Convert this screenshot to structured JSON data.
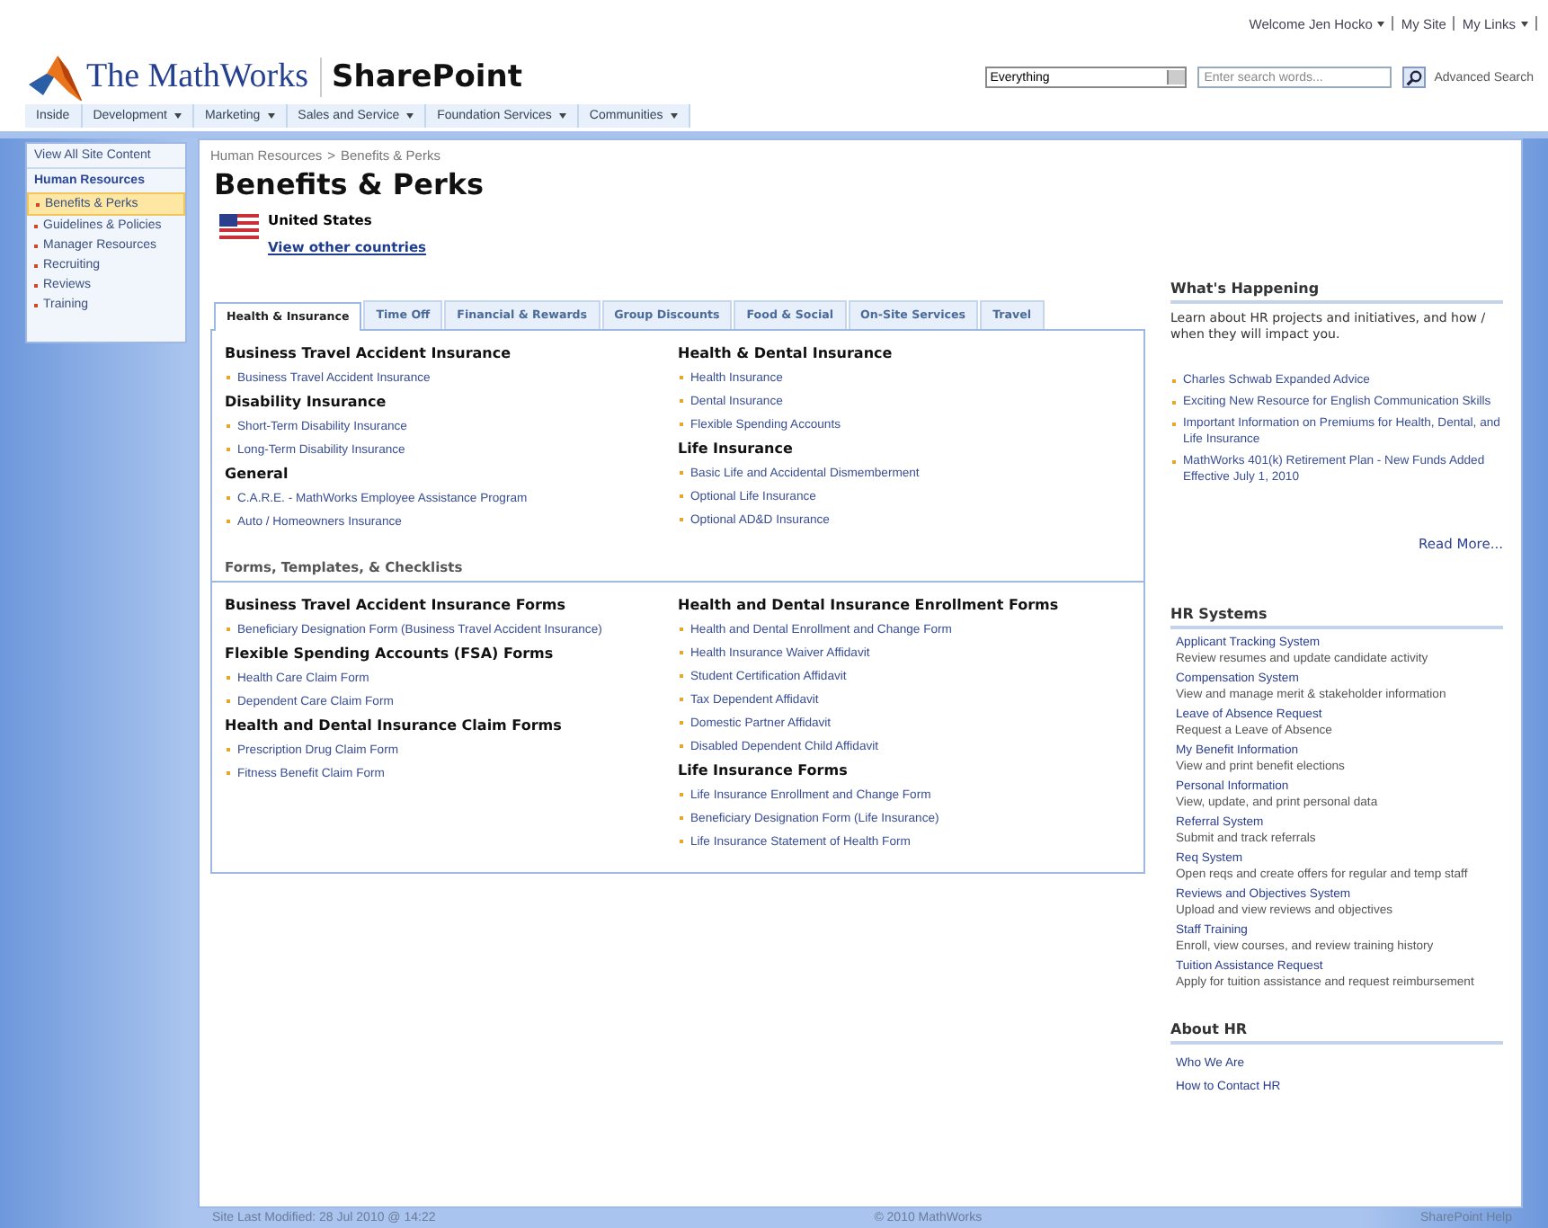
{
  "top_links": {
    "welcome": "Welcome Jen Hocko",
    "my_site": "My Site",
    "my_links": "My Links"
  },
  "logo": {
    "company": "The MathWorks",
    "product": "SharePoint"
  },
  "search": {
    "scope": "Everything",
    "placeholder": "Enter search words...",
    "advanced": "Advanced Search"
  },
  "nav": [
    {
      "label": "Inside",
      "dropdown": false
    },
    {
      "label": "Development",
      "dropdown": true
    },
    {
      "label": "Marketing",
      "dropdown": true
    },
    {
      "label": "Sales and Service",
      "dropdown": true
    },
    {
      "label": "Foundation Services",
      "dropdown": true
    },
    {
      "label": "Communities",
      "dropdown": true
    }
  ],
  "sidebar": {
    "view_all": "View All Site Content",
    "heading": "Human Resources",
    "items": [
      {
        "label": "Benefits & Perks",
        "selected": true
      },
      {
        "label": "Guidelines & Policies",
        "selected": false
      },
      {
        "label": "Manager Resources",
        "selected": false
      },
      {
        "label": "Recruiting",
        "selected": false
      },
      {
        "label": "Reviews",
        "selected": false
      },
      {
        "label": "Training",
        "selected": false
      }
    ]
  },
  "breadcrumb": {
    "parent": "Human Resources",
    "separator": ">",
    "current": "Benefits & Perks"
  },
  "title": "Benefits & Perks",
  "country": {
    "name": "United States",
    "link": "View other countries"
  },
  "tabs": [
    {
      "label": "Health & Insurance",
      "selected": true
    },
    {
      "label": "Time Off",
      "selected": false
    },
    {
      "label": "Financial & Rewards",
      "selected": false
    },
    {
      "label": "Group Discounts",
      "selected": false
    },
    {
      "label": "Food & Social",
      "selected": false
    },
    {
      "label": "On-Site Services",
      "selected": false
    },
    {
      "label": "Travel",
      "selected": false
    }
  ],
  "insurance": {
    "columns": [
      [
        {
          "heading": "Business Travel Accident Insurance",
          "links": [
            "Business Travel Accident Insurance"
          ]
        },
        {
          "heading": "Disability Insurance",
          "links": [
            "Short-Term Disability Insurance",
            "Long-Term Disability Insurance"
          ]
        },
        {
          "heading": "General",
          "links": [
            "C.A.R.E. - MathWorks Employee Assistance Program",
            "Auto / Homeowners Insurance"
          ]
        }
      ],
      [
        {
          "heading": "Health & Dental Insurance",
          "links": [
            "Health Insurance",
            "Dental Insurance",
            "Flexible Spending Accounts"
          ]
        },
        {
          "heading": "Life Insurance",
          "links": [
            "Basic Life and Accidental Dismemberment",
            "Optional Life Insurance",
            "Optional AD&D Insurance"
          ]
        }
      ]
    ]
  },
  "forms": {
    "heading": "Forms, Templates, & Checklists",
    "columns": [
      [
        {
          "heading": "Business Travel Accident Insurance Forms",
          "links": [
            "Beneficiary Designation Form (Business Travel Accident Insurance)"
          ]
        },
        {
          "heading": "Flexible Spending Accounts (FSA) Forms",
          "links": [
            "Health Care Claim Form",
            "Dependent Care Claim Form"
          ]
        },
        {
          "heading": "Health and Dental Insurance Claim Forms",
          "links": [
            "Prescription Drug Claim Form",
            "Fitness Benefit Claim Form"
          ]
        }
      ],
      [
        {
          "heading": "Health and Dental Insurance Enrollment Forms",
          "links": [
            "Health and Dental Enrollment and Change Form",
            "Health Insurance Waiver Affidavit",
            "Student Certification Affidavit",
            "Tax Dependent Affidavit",
            "Domestic Partner Affidavit",
            "Disabled Dependent Child Affidavit"
          ]
        },
        {
          "heading": "Life Insurance Forms",
          "links": [
            "Life Insurance Enrollment and Change Form",
            "Beneficiary Designation Form (Life Insurance)",
            "Life Insurance Statement of Health Form"
          ]
        }
      ]
    ]
  },
  "whats_happening": {
    "heading": "What's Happening",
    "intro": "Learn about HR projects and initiatives, and how / when they will impact you.",
    "links": [
      "Charles Schwab Expanded Advice",
      "Exciting New Resource for English Communication Skills",
      "Important Information on Premiums for Health, Dental, and Life Insurance",
      "MathWorks 401(k) Retirement Plan - New Funds Added Effective July 1, 2010"
    ],
    "more": "Read More..."
  },
  "hr_systems": {
    "heading": "HR Systems",
    "items": [
      {
        "name": "Applicant Tracking System",
        "description": "Review resumes and update candidate activity"
      },
      {
        "name": "Compensation System",
        "description": "View and manage merit & stakeholder information"
      },
      {
        "name": "Leave of Absence Request",
        "description": "Request a Leave of Absence"
      },
      {
        "name": "My Benefit Information",
        "description": "View and print benefit elections"
      },
      {
        "name": "Personal Information",
        "description": "View, update, and print personal data"
      },
      {
        "name": "Referral System",
        "description": "Submit and track referrals"
      },
      {
        "name": "Req System",
        "description": "Open reqs and create offers for regular and temp staff"
      },
      {
        "name": "Reviews and Objectives System",
        "description": "Upload and view reviews and objectives"
      },
      {
        "name": "Staff Training",
        "description": "Enroll, view courses, and review training history"
      },
      {
        "name": "Tuition Assistance Request",
        "description": "Apply for tuition assistance and request reimbursement"
      }
    ]
  },
  "about_hr": {
    "heading": "About HR",
    "links": [
      "Who We Are",
      "How to Contact HR"
    ]
  },
  "footer": {
    "modified": "Site Last Modified: 28 Jul 2010 @ 14:22",
    "copyright": "© 2010 MathWorks",
    "help": "SharePoint Help"
  }
}
